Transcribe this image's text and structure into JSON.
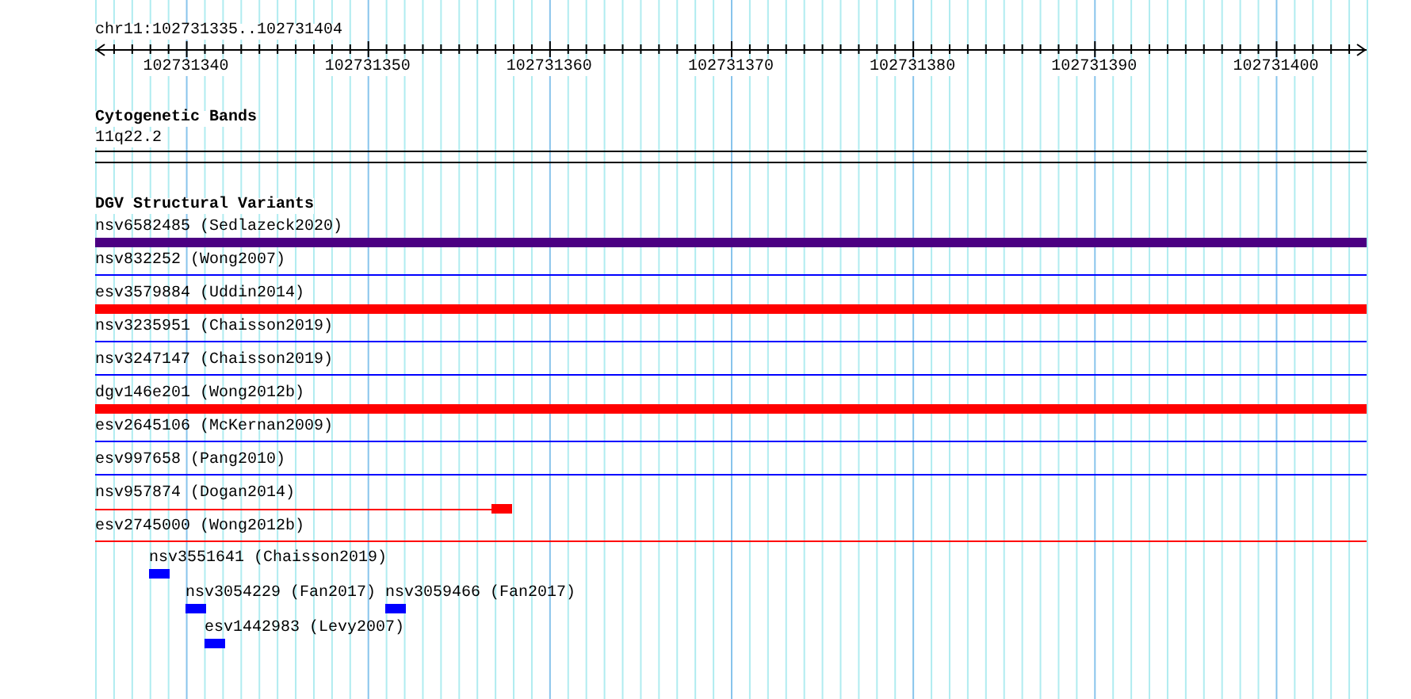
{
  "ruler": {
    "region": "chr11:102731335..102731404",
    "ticks": [
      "102731340",
      "102731350",
      "102731360",
      "102731370",
      "102731380",
      "102731390",
      "102731400"
    ]
  },
  "cytogenetic_bands": {
    "title": "Cytogenetic Bands",
    "band": "11q22.2"
  },
  "dgv_track": {
    "title": "DGV Structural Variants",
    "variants": [
      {
        "label": "nsv6582485 (Sedlazeck2020)",
        "kind": "thick",
        "color": "#4b0082"
      },
      {
        "label": "nsv832252 (Wong2007)",
        "kind": "thin",
        "color": "#0000ff"
      },
      {
        "label": "esv3579884 (Uddin2014)",
        "kind": "thick",
        "color": "#ff0000"
      },
      {
        "label": "nsv3235951 (Chaisson2019)",
        "kind": "thin",
        "color": "#0000ff"
      },
      {
        "label": "nsv3247147 (Chaisson2019)",
        "kind": "thin",
        "color": "#0000ff"
      },
      {
        "label": "dgv146e201 (Wong2012b)",
        "kind": "thick",
        "color": "#ff0000"
      },
      {
        "label": "esv2645106 (McKernan2009)",
        "kind": "thin",
        "color": "#0000ff"
      },
      {
        "label": "esv997658 (Pang2010)",
        "kind": "thin",
        "color": "#0000ff"
      },
      {
        "label": "nsv957874 (Dogan2014)",
        "kind": "partial",
        "color": "#ff0000"
      },
      {
        "label": "esv2745000 (Wong2012b)",
        "kind": "thin",
        "color": "#ff0000"
      }
    ],
    "stacked_rows": [
      [
        {
          "label": "nsv3551641 (Chaisson2019)",
          "color": "#0000ff"
        }
      ],
      [
        {
          "label": "nsv3054229 (Fan2017)",
          "color": "#0000ff"
        },
        {
          "label": "nsv3059466 (Fan2017)",
          "color": "#0000ff"
        }
      ],
      [
        {
          "label": "esv1442983 (Levy2007)",
          "color": "#0000ff"
        }
      ]
    ]
  }
}
